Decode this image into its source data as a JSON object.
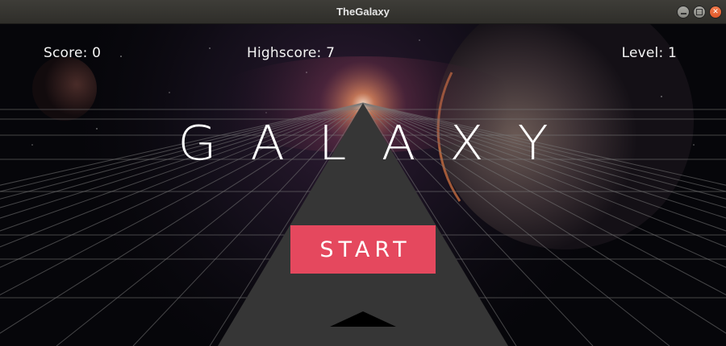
{
  "window": {
    "title": "TheGalaxy"
  },
  "hud": {
    "score": "Score: 0",
    "highscore": "Highscore: 7",
    "level": "Level: 1"
  },
  "menu": {
    "title": "GALAXY",
    "start_label": "START"
  },
  "colors": {
    "start_button": "#e5485e",
    "track": "#363636",
    "grid_lines": "#6f6f6f"
  }
}
